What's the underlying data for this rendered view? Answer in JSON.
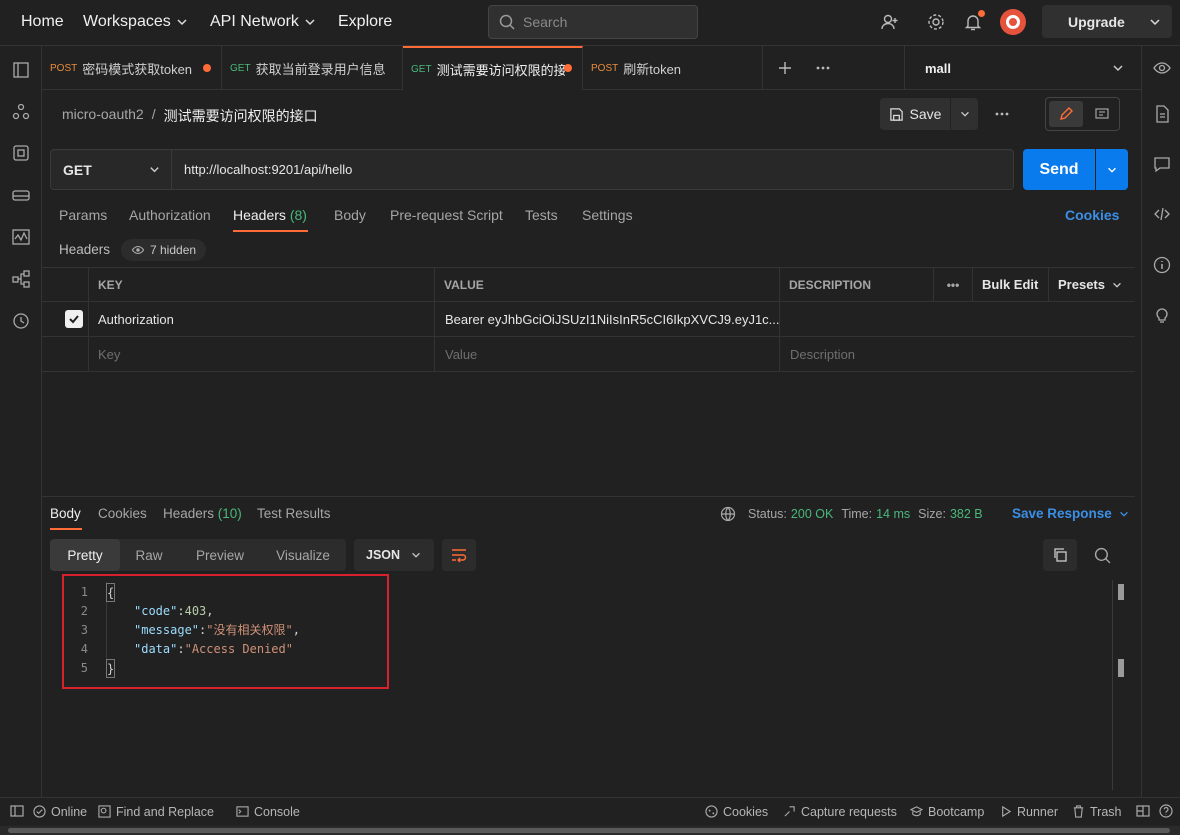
{
  "topbar": {
    "home": "Home",
    "workspaces": "Workspaces",
    "api_network": "API Network",
    "explore": "Explore",
    "search_placeholder": "Search",
    "upgrade": "Upgrade"
  },
  "tabs": [
    {
      "method": "POST",
      "label": "密码模式获取token"
    },
    {
      "method": "GET",
      "label": "获取当前登录用户信息"
    },
    {
      "method": "GET",
      "label": "测试需要访问权限的接口"
    },
    {
      "method": "POST",
      "label": "刷新token"
    }
  ],
  "environment": "mall",
  "breadcrumb": {
    "collection": "micro-oauth2",
    "separator": "/",
    "request": "测试需要访问权限的接口"
  },
  "save_label": "Save",
  "request": {
    "method": "GET",
    "url": "http://localhost:9201/api/hello",
    "send": "Send"
  },
  "request_tabs": {
    "params": "Params",
    "authorization": "Authorization",
    "headers": "Headers",
    "headers_count": "(8)",
    "body": "Body",
    "pre_request": "Pre-request Script",
    "tests": "Tests",
    "settings": "Settings",
    "cookies": "Cookies"
  },
  "headers_section": {
    "label": "Headers",
    "hidden": "7 hidden"
  },
  "table": {
    "columns": [
      "KEY",
      "VALUE",
      "DESCRIPTION"
    ],
    "more": "•••",
    "bulk_edit": "Bulk Edit",
    "presets": "Presets",
    "row": {
      "key": "Authorization",
      "value": "Bearer eyJhbGciOiJSUzI1NiIsInR5cCI6IkpXVCJ9.eyJ1c..."
    },
    "placeholders": {
      "key": "Key",
      "value": "Value",
      "description": "Description"
    }
  },
  "response": {
    "tabs": {
      "body": "Body",
      "cookies": "Cookies",
      "headers": "Headers",
      "headers_count": "(10)",
      "test_results": "Test Results"
    },
    "status_label": "Status:",
    "status": "200 OK",
    "time_label": "Time:",
    "time": "14 ms",
    "size_label": "Size:",
    "size": "382 B",
    "save_response": "Save Response",
    "views": [
      "Pretty",
      "Raw",
      "Preview",
      "Visualize"
    ],
    "format": "JSON",
    "code": {
      "open": "{",
      "key1": "\"code\"",
      "val1": "403",
      "key2": "\"message\"",
      "val2": "\"没有相关权限\"",
      "key3": "\"data\"",
      "val3": "\"Access Denied\"",
      "close": "}"
    }
  },
  "statusbar": {
    "online": "Online",
    "find_replace": "Find and Replace",
    "console": "Console",
    "cookies": "Cookies",
    "capture": "Capture requests",
    "bootcamp": "Bootcamp",
    "runner": "Runner",
    "trash": "Trash"
  },
  "colors": {
    "accent": "#ff6c37",
    "send": "#097bed",
    "success": "#49b87a",
    "highlight_box": "#d9202d"
  }
}
